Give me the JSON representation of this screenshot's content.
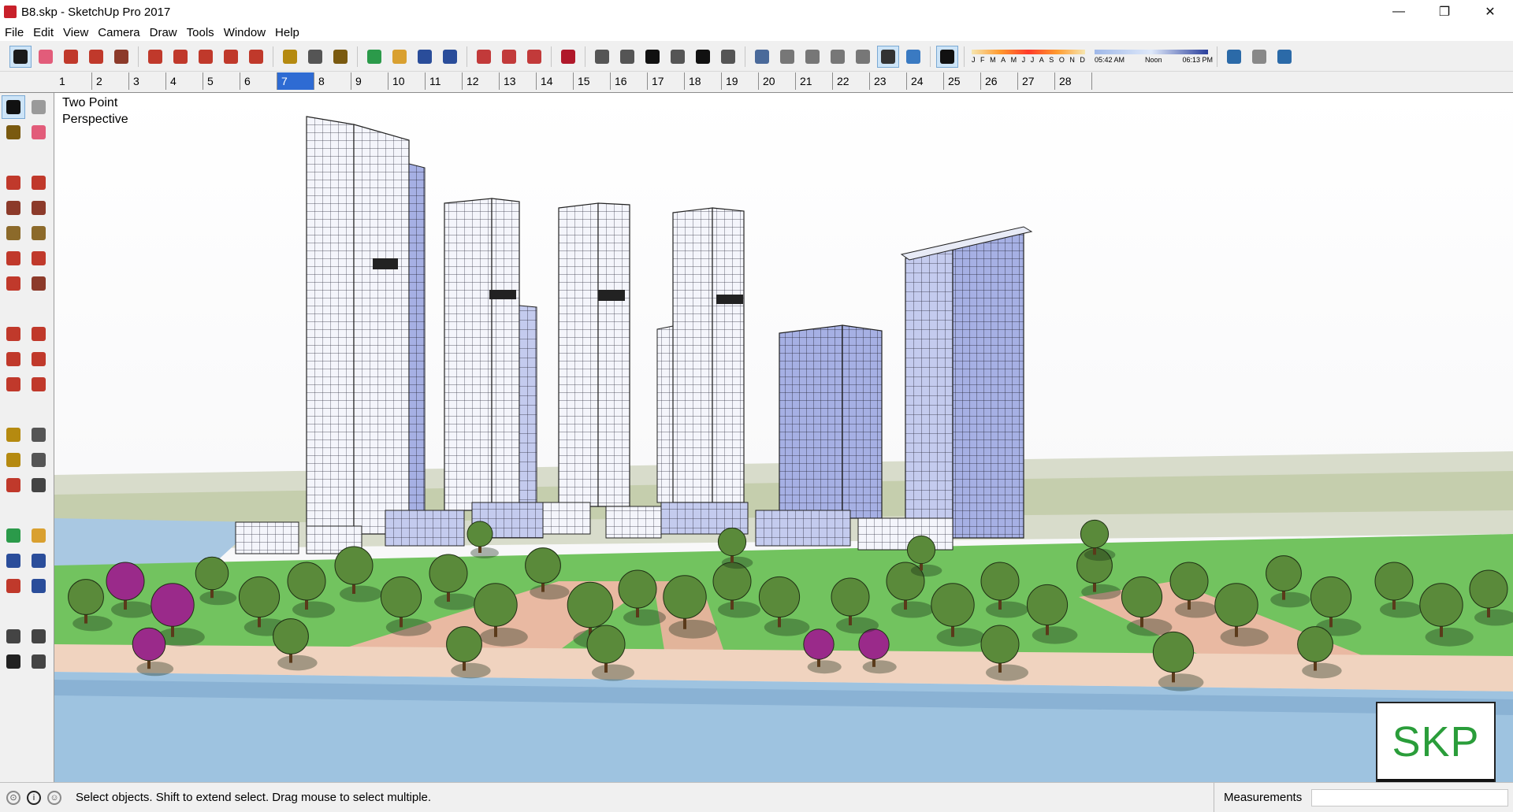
{
  "window": {
    "title": "B8.skp - SketchUp Pro 2017",
    "minimize_glyph": "—",
    "restore_glyph": "❐",
    "close_glyph": "✕"
  },
  "menu": [
    "File",
    "Edit",
    "View",
    "Camera",
    "Draw",
    "Tools",
    "Window",
    "Help"
  ],
  "toolbar": {
    "groups": [
      [
        {
          "icon": "select-icon",
          "color": "#1a1a1a",
          "active": true
        },
        {
          "icon": "eraser-icon",
          "color": "#e25c7a"
        },
        {
          "icon": "pencil-icon",
          "color": "#c0392b"
        },
        {
          "icon": "arc-icon",
          "color": "#c0392b"
        },
        {
          "icon": "rectangle-icon",
          "color": "#8c3a2a"
        }
      ],
      [
        {
          "icon": "push-pull-icon",
          "color": "#c0392b"
        },
        {
          "icon": "follow-me-icon",
          "color": "#c0392b"
        },
        {
          "icon": "move-icon",
          "color": "#c0392b"
        },
        {
          "icon": "rotate-icon",
          "color": "#c0392b"
        },
        {
          "icon": "scale-icon",
          "color": "#c0392b"
        }
      ],
      [
        {
          "icon": "tape-measure-icon",
          "color": "#b58a10"
        },
        {
          "icon": "text-icon",
          "color": "#555555"
        },
        {
          "icon": "paint-bucket-icon",
          "color": "#7a5a10"
        }
      ],
      [
        {
          "icon": "orbit-icon",
          "color": "#2b9a4a"
        },
        {
          "icon": "pan-icon",
          "color": "#d9a030"
        },
        {
          "icon": "zoom-icon",
          "color": "#2a4d9a"
        },
        {
          "icon": "zoom-extents-icon",
          "color": "#2a4d9a"
        }
      ],
      [
        {
          "icon": "warehouse-icon",
          "color": "#c23a3a"
        },
        {
          "icon": "extension-warehouse-icon",
          "color": "#c23a3a"
        },
        {
          "icon": "layout-icon",
          "color": "#c23a3a"
        }
      ],
      [
        {
          "icon": "ruby-icon",
          "color": "#b0182a"
        }
      ],
      [
        {
          "icon": "iso-view-icon",
          "color": "#555555"
        },
        {
          "icon": "top-view-icon",
          "color": "#555555"
        },
        {
          "icon": "front-view-icon",
          "color": "#111111"
        },
        {
          "icon": "right-view-icon",
          "color": "#555555"
        },
        {
          "icon": "back-view-icon",
          "color": "#111111"
        },
        {
          "icon": "left-view-icon",
          "color": "#555555"
        }
      ],
      [
        {
          "icon": "xray-icon",
          "color": "#4a6a9a"
        },
        {
          "icon": "back-edges-icon",
          "color": "#777777"
        },
        {
          "icon": "wireframe-icon",
          "color": "#777777"
        },
        {
          "icon": "hidden-line-icon",
          "color": "#777777"
        },
        {
          "icon": "shaded-icon",
          "color": "#777777"
        },
        {
          "icon": "shaded-textures-icon",
          "color": "#333333",
          "active": true
        },
        {
          "icon": "monochrome-icon",
          "color": "#3a7ac2"
        }
      ],
      [
        {
          "icon": "shadows-icon",
          "color": "#111111",
          "active": true
        }
      ]
    ],
    "sun": {
      "months": [
        "J",
        "F",
        "M",
        "A",
        "M",
        "J",
        "J",
        "A",
        "S",
        "O",
        "N",
        "D"
      ],
      "time_start": "05:42 AM",
      "time_noon": "Noon",
      "time_end": "06:13 PM"
    },
    "tail_icons": [
      {
        "icon": "geo-location-icon",
        "color": "#2b6aa8"
      },
      {
        "icon": "photo-texture-icon",
        "color": "#888888"
      },
      {
        "icon": "add-location-icon",
        "color": "#2b6aa8"
      }
    ]
  },
  "scenes": {
    "tabs": [
      "1",
      "2",
      "3",
      "4",
      "5",
      "6",
      "7",
      "8",
      "9",
      "10",
      "11",
      "12",
      "13",
      "14",
      "15",
      "16",
      "17",
      "18",
      "19",
      "20",
      "21",
      "22",
      "23",
      "24",
      "25",
      "26",
      "27",
      "28"
    ],
    "active_index": 6
  },
  "left_tools": {
    "groups": [
      [
        {
          "icon": "select-tool-icon",
          "color": "#111111",
          "active": true
        },
        {
          "icon": "make-component-icon",
          "color": "#9a9a9a"
        },
        {
          "icon": "paint-bucket-tool-icon",
          "color": "#7a5a10"
        },
        {
          "icon": "eraser-tool-icon",
          "color": "#e25c7a"
        }
      ],
      [
        {
          "icon": "line-tool-icon",
          "color": "#c0392b"
        },
        {
          "icon": "freehand-tool-icon",
          "color": "#c0392b"
        },
        {
          "icon": "rectangle-tool-icon",
          "color": "#8c3a2a"
        },
        {
          "icon": "rotated-rectangle-tool-icon",
          "color": "#8c3a2a"
        },
        {
          "icon": "circle-tool-icon",
          "color": "#8c6a2a"
        },
        {
          "icon": "polygon-tool-icon",
          "color": "#8c6a2a"
        },
        {
          "icon": "arc-tool-icon",
          "color": "#c0392b"
        },
        {
          "icon": "two-point-arc-tool-icon",
          "color": "#c0392b"
        },
        {
          "icon": "three-point-arc-tool-icon",
          "color": "#c0392b"
        },
        {
          "icon": "pie-tool-icon",
          "color": "#8c3a2a"
        }
      ],
      [
        {
          "icon": "move-tool-icon",
          "color": "#c0392b"
        },
        {
          "icon": "push-pull-tool-icon",
          "color": "#c0392b"
        },
        {
          "icon": "rotate-tool-icon",
          "color": "#c0392b"
        },
        {
          "icon": "follow-me-tool-icon",
          "color": "#c0392b"
        },
        {
          "icon": "scale-tool-icon",
          "color": "#c0392b"
        },
        {
          "icon": "offset-tool-icon",
          "color": "#c0392b"
        }
      ],
      [
        {
          "icon": "tape-measure-tool-icon",
          "color": "#b58a10"
        },
        {
          "icon": "dimension-tool-icon",
          "color": "#555555"
        },
        {
          "icon": "protractor-tool-icon",
          "color": "#b58a10"
        },
        {
          "icon": "text-tool-icon",
          "color": "#555555"
        },
        {
          "icon": "axes-tool-icon",
          "color": "#c0392b"
        },
        {
          "icon": "3d-text-tool-icon",
          "color": "#444444"
        }
      ],
      [
        {
          "icon": "orbit-tool-icon",
          "color": "#2b9a4a"
        },
        {
          "icon": "pan-tool-icon",
          "color": "#d9a030"
        },
        {
          "icon": "zoom-tool-icon",
          "color": "#2a4d9a"
        },
        {
          "icon": "zoom-window-tool-icon",
          "color": "#2a4d9a"
        },
        {
          "icon": "zoom-extents-tool-icon",
          "color": "#c0392b"
        },
        {
          "icon": "previous-view-tool-icon",
          "color": "#2a4d9a"
        }
      ],
      [
        {
          "icon": "position-camera-tool-icon",
          "color": "#444444"
        },
        {
          "icon": "look-around-tool-icon",
          "color": "#444444"
        },
        {
          "icon": "walk-tool-icon",
          "color": "#222222"
        },
        {
          "icon": "section-plane-tool-icon",
          "color": "#444444"
        }
      ]
    ]
  },
  "viewport": {
    "label_line1": "Two Point",
    "label_line2": "Perspective",
    "watermark": "SKP"
  },
  "status": {
    "message": "Select objects. Shift to extend select. Drag mouse to select multiple.",
    "measurements_label": "Measurements",
    "measurements_value": "",
    "icons": [
      {
        "icon": "geo-location-status-icon",
        "glyph": "⊙"
      },
      {
        "icon": "credits-status-icon",
        "glyph": "i"
      },
      {
        "icon": "user-status-icon",
        "glyph": "☺"
      }
    ]
  },
  "colors": {
    "sky": "#ffffff",
    "water": "#9ec3e0",
    "grass": "#6cc45a",
    "plaza": "#e8b8a0",
    "tower_glass": "#aab4e6",
    "tree": "#5a8a3a",
    "tree_purple": "#9a2a8a",
    "accent_scene_tab": "#2e6bd3",
    "skp_green": "#2a9d3a"
  }
}
